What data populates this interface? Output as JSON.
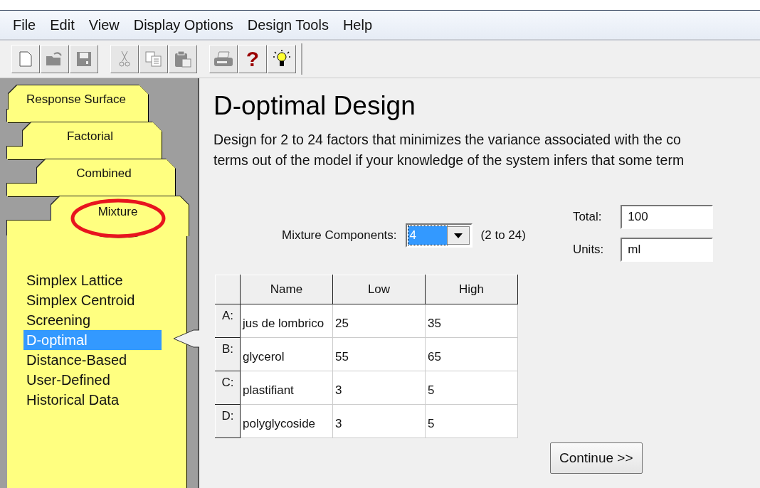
{
  "menu": [
    "File",
    "Edit",
    "View",
    "Display Options",
    "Design Tools",
    "Help"
  ],
  "toolbar": [
    {
      "kind": "new",
      "disabled": false
    },
    {
      "kind": "open",
      "disabled": true
    },
    {
      "kind": "save",
      "disabled": true
    },
    {
      "kind": "sep"
    },
    {
      "kind": "cut",
      "disabled": true
    },
    {
      "kind": "copy",
      "disabled": true
    },
    {
      "kind": "paste",
      "disabled": true
    },
    {
      "kind": "sep"
    },
    {
      "kind": "print",
      "disabled": true
    },
    {
      "kind": "help",
      "label": "?",
      "disabled": false
    },
    {
      "kind": "tips",
      "disabled": false
    }
  ],
  "tabs": [
    {
      "label": "Response Surface",
      "selected": false
    },
    {
      "label": "Factorial",
      "selected": false
    },
    {
      "label": "Combined",
      "selected": false
    },
    {
      "label": "Mixture",
      "selected": true
    }
  ],
  "design_list": [
    {
      "label": "Simplex Lattice",
      "selected": false
    },
    {
      "label": "Simplex Centroid",
      "selected": false
    },
    {
      "label": "Screening",
      "selected": false
    },
    {
      "label": "D-optimal",
      "selected": true
    },
    {
      "label": "Distance-Based",
      "selected": false
    },
    {
      "label": "User-Defined",
      "selected": false
    },
    {
      "label": "Historical Data",
      "selected": false
    }
  ],
  "title": "D-optimal Design",
  "description": [
    "Design for 2 to 24 factors that minimizes the variance associated with the co",
    "terms out of the model if your knowledge of the system infers that some term"
  ],
  "components": {
    "label": "Mixture Components:",
    "value": "4",
    "range": "(2 to 24)"
  },
  "total": {
    "label": "Total:",
    "value": "100"
  },
  "units": {
    "label": "Units:",
    "value": "ml"
  },
  "table": {
    "columns": [
      "Name",
      "Low",
      "High"
    ],
    "rows": [
      {
        "id": "A:",
        "cells": [
          "jus de lombrico",
          "25",
          "35"
        ]
      },
      {
        "id": "B:",
        "cells": [
          "glycerol",
          "55",
          "65"
        ]
      },
      {
        "id": "C:",
        "cells": [
          "plastifiant",
          "3",
          "5"
        ]
      },
      {
        "id": "D:",
        "cells": [
          "polyglycoside",
          "3",
          "5"
        ]
      }
    ]
  },
  "continue_button": "Continue >>"
}
